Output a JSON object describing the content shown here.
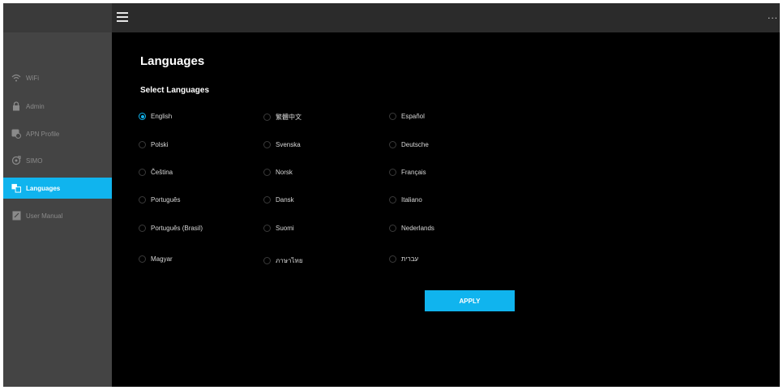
{
  "header": {
    "menu_icon": "hamburger-icon",
    "more_label": "..."
  },
  "sidebar": {
    "items": [
      {
        "label": "WiFi",
        "icon": "wifi-icon",
        "active": false
      },
      {
        "label": "Admin",
        "icon": "lock-icon",
        "active": false
      },
      {
        "label": "APN Profile",
        "icon": "apn-icon",
        "active": false
      },
      {
        "label": "SIMO",
        "icon": "sim-icon",
        "active": false
      },
      {
        "label": "Languages",
        "icon": "languages-icon",
        "active": true
      },
      {
        "label": "User Manual",
        "icon": "manual-icon",
        "active": false
      }
    ]
  },
  "main": {
    "title": "Languages",
    "section_title": "Select Languages",
    "languages": [
      [
        "English",
        "繁體中文",
        "Español"
      ],
      [
        "Polski",
        "Svenska",
        "Deutsche"
      ],
      [
        "Čeština",
        "Norsk",
        "Français"
      ],
      [
        "Português",
        "Dansk",
        "Italiano"
      ],
      [
        "Português (Brasil)",
        "Suomi",
        "Nederlands"
      ],
      [
        "Magyar",
        "ภาษาไทย",
        "עברית"
      ]
    ],
    "selected": "English",
    "apply_label": "APPLY"
  },
  "colors": {
    "accent": "#10b4ee",
    "sidebar_bg": "#444444",
    "topbar_bg": "#2b2b2b",
    "main_bg": "#000000"
  }
}
